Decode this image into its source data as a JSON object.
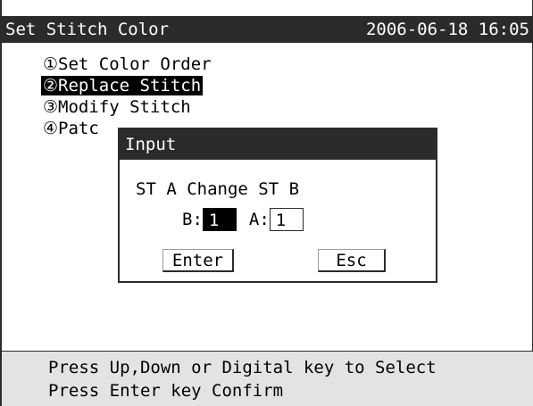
{
  "header": {
    "title": "Set Stitch Color",
    "datetime": "2006-06-18 16:05"
  },
  "menu": {
    "items": [
      {
        "label": "①Set Color Order"
      },
      {
        "label": "②Replace Stitch"
      },
      {
        "label": "③Modify Stitch"
      },
      {
        "label": "④Patc"
      }
    ],
    "selected_index": 1
  },
  "dialog": {
    "title": "Input",
    "prompt": "ST A Change ST B",
    "field_b_label": "B:",
    "field_b_value": "1",
    "field_a_label": "A:",
    "field_a_value": "1",
    "enter_label": "Enter",
    "esc_label": "Esc"
  },
  "footer": {
    "line1": "Press Up,Down or Digital key to  Select",
    "line2": "Press Enter key Confirm"
  },
  "colors": {
    "bar": "#2b2b2b",
    "highlight": "#000000",
    "footer_bg": "#e3e3e3"
  }
}
